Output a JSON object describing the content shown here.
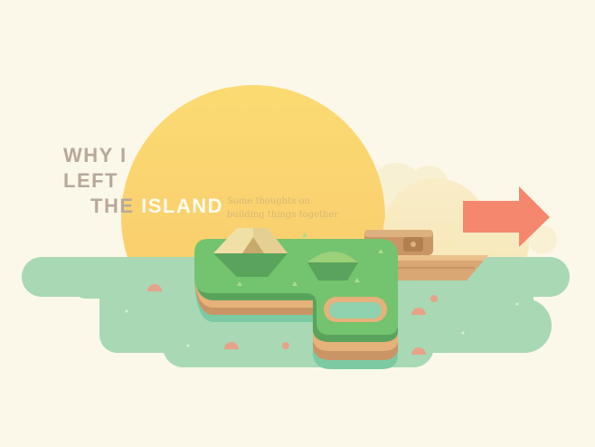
{
  "title": {
    "line1": "WHY I",
    "line2": "LEFT",
    "line3_prefix": "THE",
    "line3_accent": "ISLAND"
  },
  "subtitle": {
    "line1": "Some thoughts on",
    "line2": "building things together"
  },
  "colors": {
    "background": "#fbf8ea",
    "sun": "#fbd86a",
    "water": "#a6d7b5",
    "grass": "#72c26d",
    "arrow": "#f5876d",
    "title_text": "#b8a89a",
    "title_accent": "#fdfbf0",
    "subtitle_text": "#d9b87a"
  },
  "icons": [
    "sun",
    "cloud",
    "island",
    "tent",
    "tree",
    "pond",
    "boat",
    "arrow-right",
    "buoy"
  ]
}
